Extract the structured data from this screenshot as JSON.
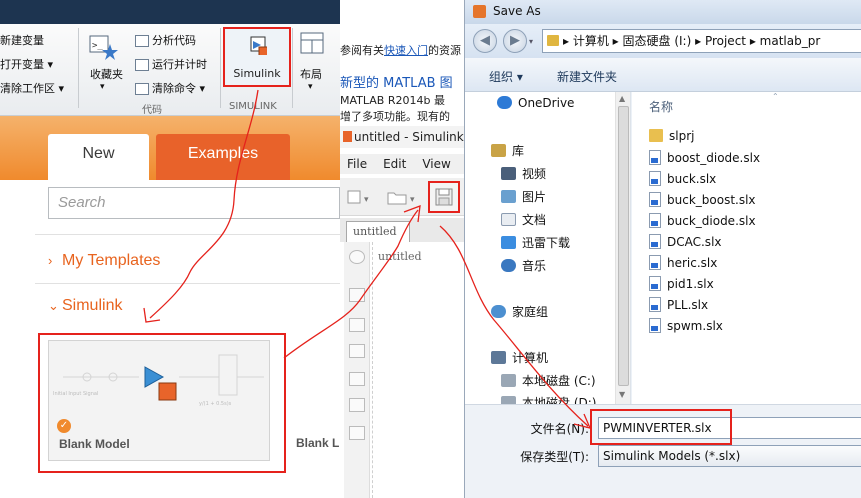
{
  "toolstrip": {
    "new_variable": "新建变量",
    "open_variable": "打开变量",
    "clear_workspace": "清除工作区",
    "favorites": "收藏夹",
    "analyze_code": "分析代码",
    "run_and_time": "运行并计时",
    "clear_commands": "清除命令",
    "code_group": "代码",
    "simulink_label": "Simulink",
    "simulink_group": "SIMULINK",
    "layout": "布局"
  },
  "start_panel": {
    "tab_new": "New",
    "tab_examples": "Examples",
    "search_placeholder": "Search",
    "my_templates": "My Templates",
    "simulink_section": "Simulink",
    "blank_model": "Blank Model",
    "blank_library": "Blank L",
    "thumb_text_1": "Initial Input Signal",
    "thumb_text_2": "y/(1 + 0.5s)s"
  },
  "simulink_editor": {
    "banner_line1_prefix": "参阅有关",
    "banner_line1_link": "快速入门",
    "banner_line1_suffix": "的资源",
    "banner_line2": "新型的 MATLAB 图",
    "banner_line3": "MATLAB R2014b 最",
    "banner_line4": "增了多项功能。现有的",
    "title": "untitled - Simulink",
    "menu_file": "File",
    "menu_edit": "Edit",
    "menu_view": "View",
    "tab_label": "untitled",
    "canvas_label": "untitled"
  },
  "dialog": {
    "title": "Save As",
    "breadcrumb": [
      "计算机",
      "固态硬盘 (I:)",
      "Project",
      "matlab_pr"
    ],
    "organize": "组织 ▾",
    "new_folder": "新建文件夹",
    "nav_items": [
      {
        "label": "OneDrive",
        "icon": "cloud-icon"
      },
      {
        "label": "库",
        "icon": "library-icon"
      },
      {
        "label": "视频",
        "icon": "video-icon"
      },
      {
        "label": "图片",
        "icon": "picture-icon"
      },
      {
        "label": "文档",
        "icon": "document-icon"
      },
      {
        "label": "迅雷下载",
        "icon": "download-icon"
      },
      {
        "label": "音乐",
        "icon": "music-icon"
      },
      {
        "label": "家庭组",
        "icon": "homegroup-icon"
      },
      {
        "label": "计算机",
        "icon": "computer-icon"
      },
      {
        "label": "本地磁盘 (C:)",
        "icon": "drive-icon"
      },
      {
        "label": "本地磁盘 (D:)",
        "icon": "drive-icon"
      }
    ],
    "column_name": "名称",
    "files": [
      "slprj",
      "boost_diode.slx",
      "buck.slx",
      "buck_boost.slx",
      "buck_diode.slx",
      "DCAC.slx",
      "heric.slx",
      "pid1.slx",
      "PLL.slx",
      "spwm.slx"
    ],
    "filename_label": "文件名(N):",
    "filename_value": "PWMINVERTER.slx",
    "filetype_label": "保存类型(T):",
    "filetype_value": "Simulink Models (*.slx)"
  },
  "colors": {
    "highlight": "#e5221c",
    "orange_tab": "#e8622a",
    "matlab_banner": "#1d3450"
  }
}
